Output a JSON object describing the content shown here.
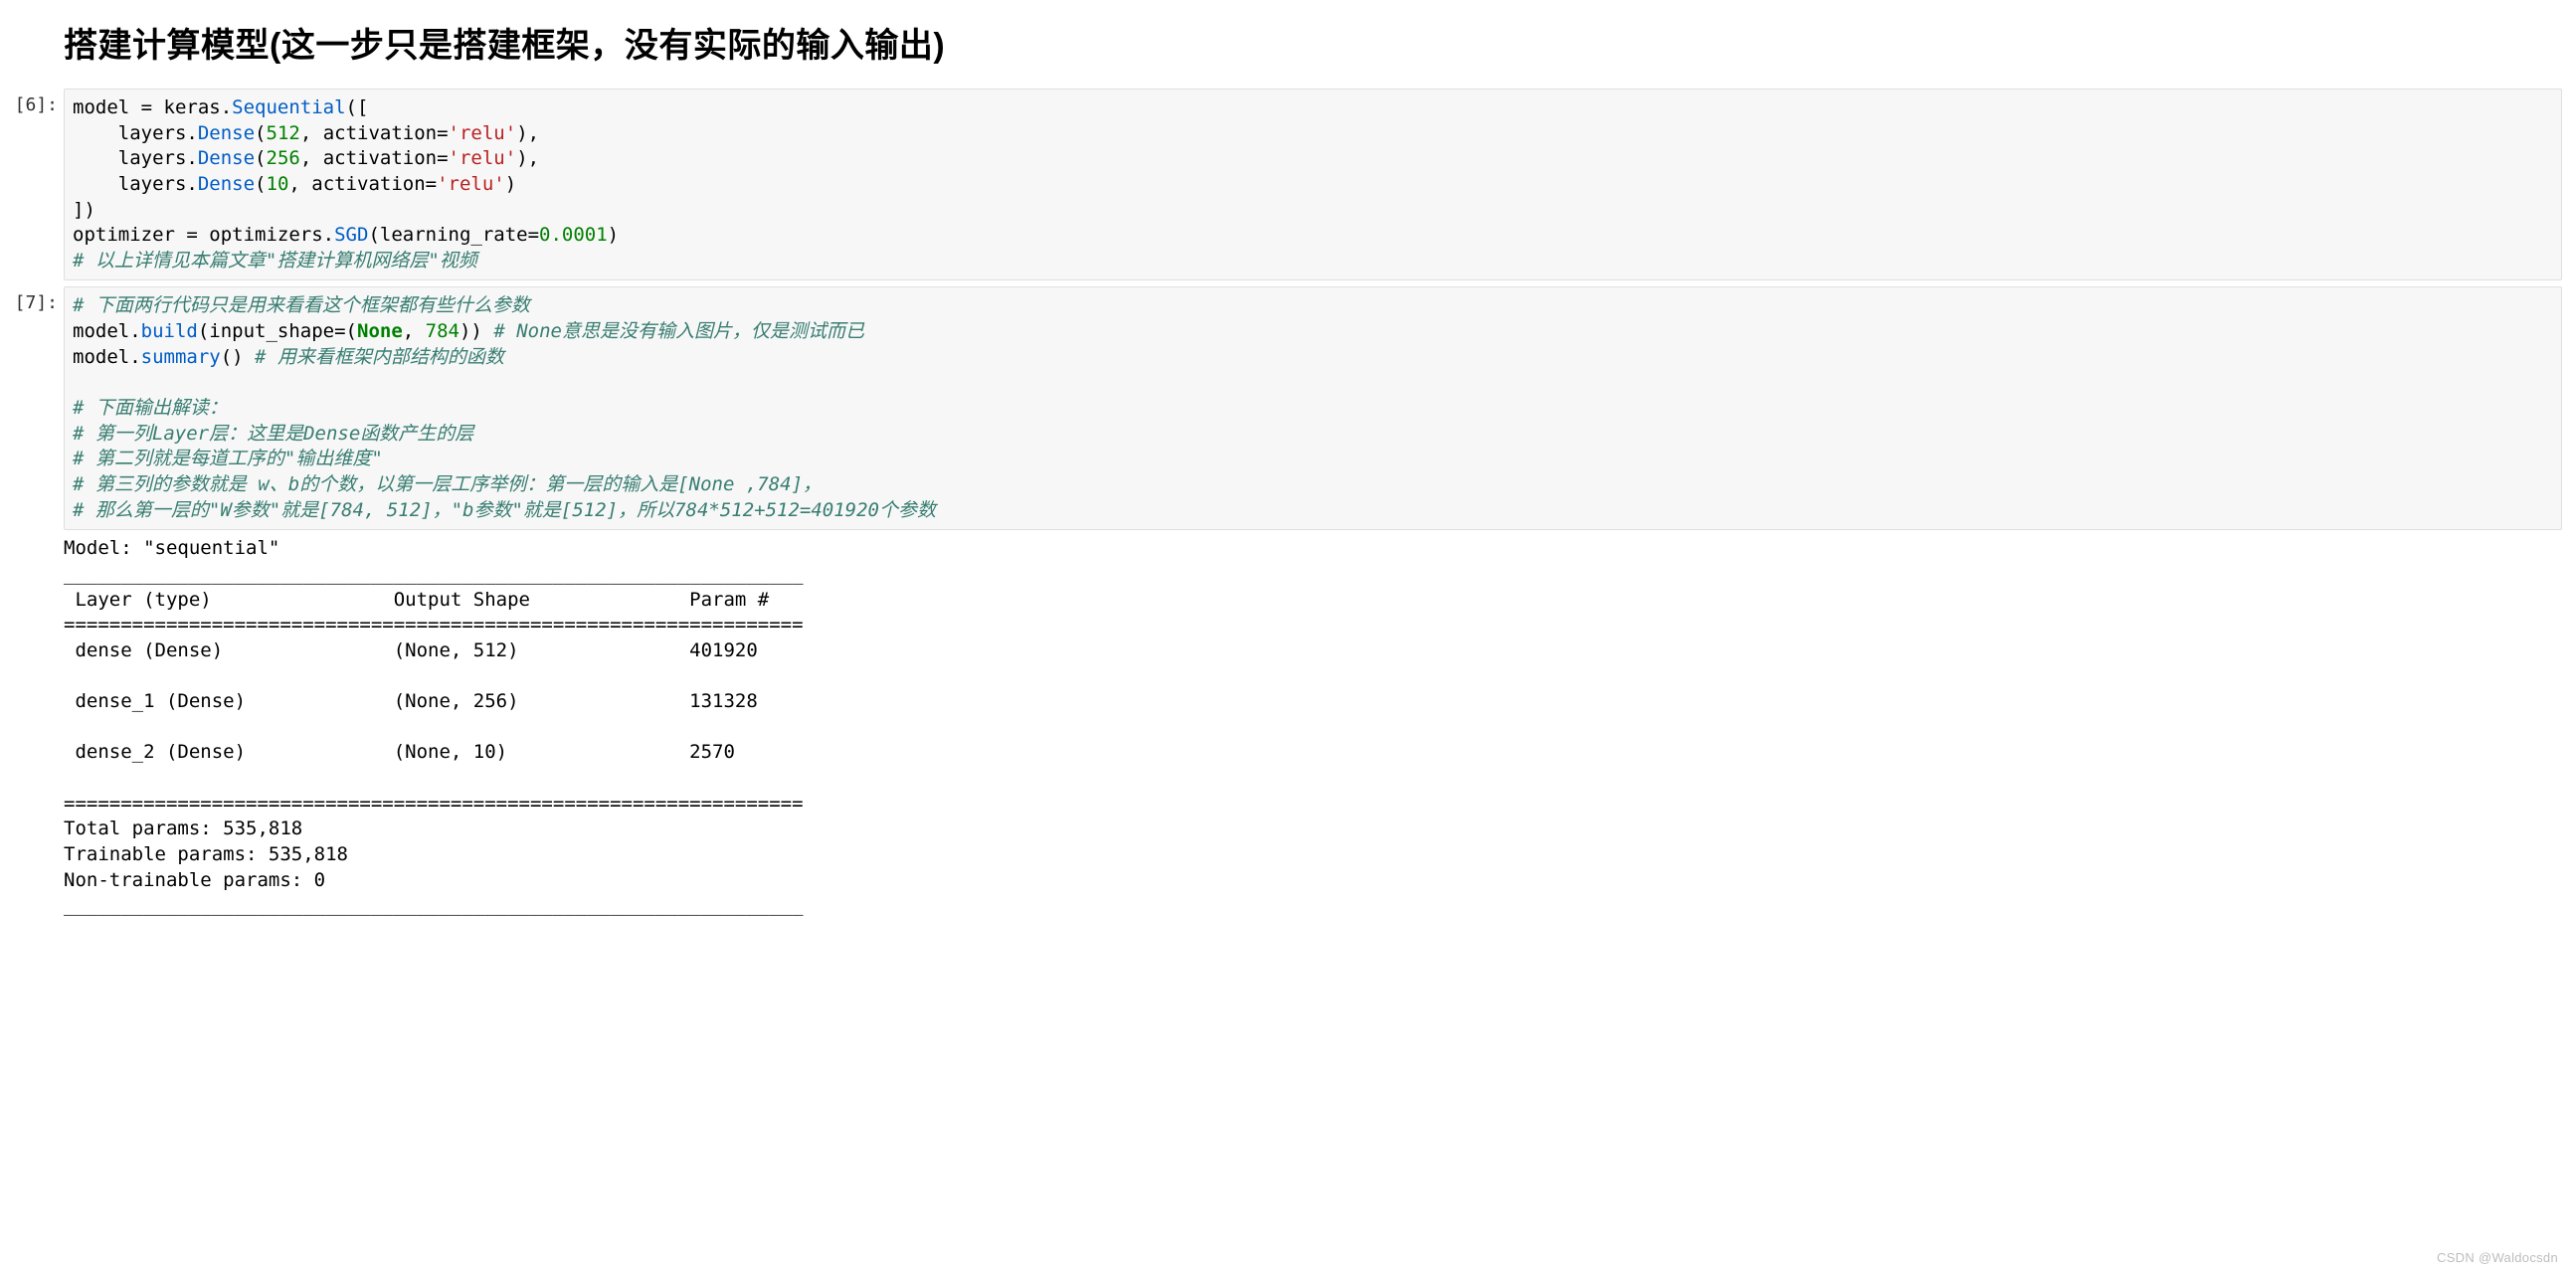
{
  "heading": "搭建计算模型(这一步只是搭建框架，没有实际的输入输出)",
  "watermark": "CSDN @Waldocsdn",
  "cells": [
    {
      "prompt": "[6]:",
      "tokens": [
        [
          [
            "",
            "model = keras."
          ],
          [
            "call",
            "Sequential"
          ],
          [
            "",
            "(["
          ]
        ],
        [
          [
            "",
            "    layers."
          ],
          [
            "call",
            "Dense"
          ],
          [
            "",
            "("
          ],
          [
            "num",
            "512"
          ],
          [
            "",
            ", activation="
          ],
          [
            "str",
            "'relu'"
          ],
          [
            "",
            "),"
          ]
        ],
        [
          [
            "",
            "    layers."
          ],
          [
            "call",
            "Dense"
          ],
          [
            "",
            "("
          ],
          [
            "num",
            "256"
          ],
          [
            "",
            ", activation="
          ],
          [
            "str",
            "'relu'"
          ],
          [
            "",
            "),"
          ]
        ],
        [
          [
            "",
            "    layers."
          ],
          [
            "call",
            "Dense"
          ],
          [
            "",
            "("
          ],
          [
            "num",
            "10"
          ],
          [
            "",
            ", activation="
          ],
          [
            "str",
            "'relu'"
          ],
          [
            "",
            ")"
          ]
        ],
        [
          [
            "",
            "])"
          ]
        ],
        [
          [
            "",
            "optimizer = optimizers."
          ],
          [
            "call",
            "SGD"
          ],
          [
            "",
            "(learning_rate="
          ],
          [
            "num",
            "0.0001"
          ],
          [
            "",
            ")"
          ]
        ],
        [
          [
            "cmt",
            "# 以上详情见本篇文章\"搭建计算机网络层\"视频"
          ]
        ]
      ]
    },
    {
      "prompt": "[7]:",
      "tokens": [
        [
          [
            "cmt",
            "# 下面两行代码只是用来看看这个框架都有些什么参数"
          ]
        ],
        [
          [
            "",
            "model."
          ],
          [
            "call",
            "build"
          ],
          [
            "",
            "(input_shape=("
          ],
          [
            "kw",
            "None"
          ],
          [
            "",
            ", "
          ],
          [
            "num",
            "784"
          ],
          [
            "",
            ")) "
          ],
          [
            "cmt",
            "# None意思是没有输入图片，仅是测试而已"
          ]
        ],
        [
          [
            "",
            "model."
          ],
          [
            "call",
            "summary"
          ],
          [
            "",
            "() "
          ],
          [
            "cmt",
            "# 用来看框架内部结构的函数"
          ]
        ],
        [
          [
            "",
            ""
          ]
        ],
        [
          [
            "cmt",
            "# 下面输出解读："
          ]
        ],
        [
          [
            "cmt",
            "# 第一列Layer层：这里是Dense函数产生的层"
          ]
        ],
        [
          [
            "cmt",
            "# 第二列就是每道工序的\"输出维度\""
          ]
        ],
        [
          [
            "cmt",
            "# 第三列的参数就是 w、b的个数，以第一层工序举例：第一层的输入是[None ,784]，"
          ]
        ],
        [
          [
            "cmt",
            "# 那么第一层的\"W参数\"就是[784, 512]，\"b参数\"就是[512]，所以784*512+512=401920个参数"
          ]
        ]
      ]
    }
  ],
  "output_lines": [
    "Model: \"sequential\"",
    "_________________________________________________________________",
    " Layer (type)                Output Shape              Param #   ",
    "=================================================================",
    " dense (Dense)               (None, 512)               401920    ",
    "                                                                 ",
    " dense_1 (Dense)             (None, 256)               131328    ",
    "                                                                 ",
    " dense_2 (Dense)             (None, 10)                2570      ",
    "                                                                 ",
    "=================================================================",
    "Total params: 535,818",
    "Trainable params: 535,818",
    "Non-trainable params: 0",
    "_________________________________________________________________"
  ]
}
